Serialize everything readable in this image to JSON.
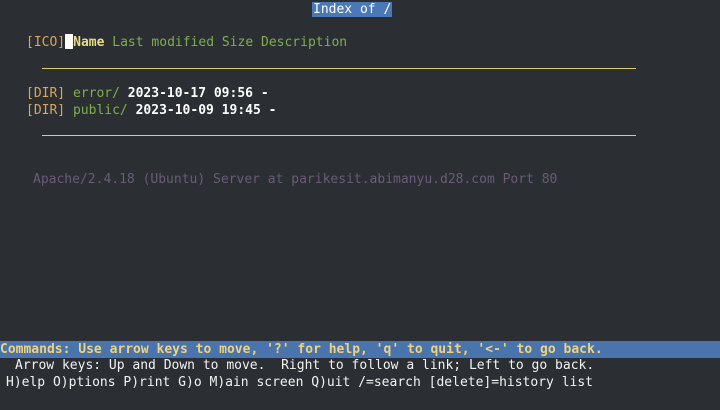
{
  "window": {
    "title": "Index of /"
  },
  "listing": {
    "icon_header": "[ICO]",
    "columns": {
      "name": "Name",
      "last_modified": "Last modified",
      "size": "Size",
      "description": "Description"
    },
    "entries": [
      {
        "tag": "[DIR]",
        "name": "error/",
        "modified": "2023-10-17 09:56",
        "size": "-"
      },
      {
        "tag": "[DIR]",
        "name": "public/",
        "modified": "2023-10-09 19:45",
        "size": "-"
      }
    ]
  },
  "footer": {
    "server_signature": "Apache/2.4.18 (Ubuntu) Server at parikesit.abimanyu.d28.com Port 80"
  },
  "status": {
    "commands": "Commands: Use arrow keys to move, '?' for help, 'q' to quit, '<-' to go back.",
    "arrow_help": "Arrow keys: Up and Down to move.  Right to follow a link; Left to go back.",
    "key_help": "H)elp O)ptions P)rint G)o M)ain screen Q)uit /=search [delete]=history list"
  },
  "colors": {
    "background": "#2b2f33",
    "title_bg": "#4b78b6",
    "link": "#7fae4e",
    "tag": "#d9a55a",
    "rule": "#d9cf63",
    "command_bar": "#4a74ad"
  }
}
